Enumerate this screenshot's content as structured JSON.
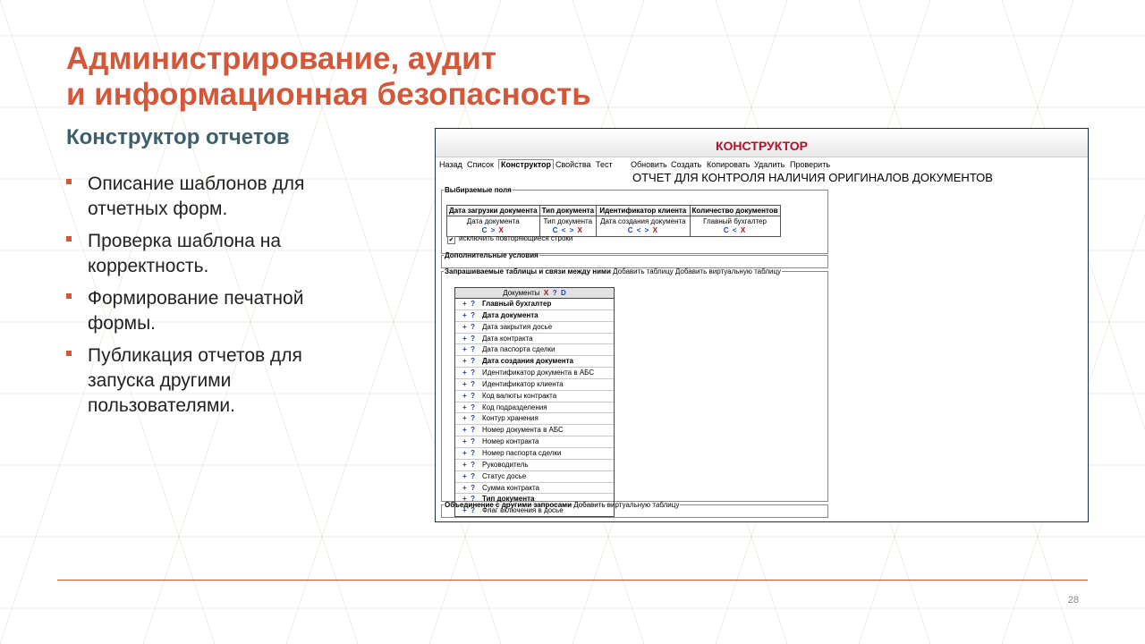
{
  "slide": {
    "title_line1": "Администрирование, аудит",
    "title_line2": "и информационная безопасность",
    "subtitle": "Конструктор отчетов",
    "bullets": [
      "Описание шаблонов для отчетных форм.",
      "Проверка шаблона на корректность.",
      "Формирование печатной формы.",
      "Публикация отчетов для запуска другими пользователями."
    ],
    "page_number": "28",
    "colors": {
      "accent": "#d4573a",
      "subtitle": "#3c5f6b",
      "header_red": "#b2102c",
      "control_blue": "#1a3cc8",
      "control_red": "#d20000"
    }
  },
  "screenshot": {
    "header": "КОНСТРУКТОР",
    "nav": [
      "Назад",
      "Список",
      "Конструктор",
      "Свойства",
      "Тест"
    ],
    "actions": [
      "Обновить",
      "Создать",
      "Копировать",
      "Удалить",
      "Проверить"
    ],
    "report_title": "ОТЧЕТ ДЛЯ КОНТРОЛЯ НАЛИЧИЯ ОРИГИНАЛОВ ДОКУМЕНТОВ",
    "selected_fields": {
      "legend": "Выбираемые поля",
      "columns": [
        {
          "header": "Дата загрузки документа",
          "value": "Дата документа",
          "controls": [
            "C",
            ">",
            "X"
          ]
        },
        {
          "header": "Тип документа",
          "value": "Тип документа",
          "controls": [
            "C",
            "<",
            ">",
            "X"
          ]
        },
        {
          "header": "Идентификатор клиента",
          "value": "Дата создания документа",
          "controls": [
            "C",
            "<",
            ">",
            "X"
          ]
        },
        {
          "header": "Количество документов",
          "value": "Главный бухгалтер",
          "controls": [
            "C",
            "<",
            "X"
          ]
        }
      ],
      "exclude_duplicates_label": "исключить повторяющиеся строки",
      "exclude_duplicates_checked": true
    },
    "additional_conditions": {
      "legend": "Дополнительные условия"
    },
    "tables_section": {
      "legend": "Запрашиваемые таблицы и связи между ними",
      "add_table": "Добавить таблицу",
      "add_virtual_table": "Добавить виртуальную таблицу",
      "documents_table": {
        "title": "Документы",
        "controls": [
          "X",
          "?",
          "D"
        ],
        "row_buttons": [
          "+",
          "?"
        ],
        "rows": [
          {
            "label": "Главный бухгалтер",
            "bold": true
          },
          {
            "label": "Дата документа",
            "bold": true
          },
          {
            "label": "Дата закрытия досье",
            "bold": false
          },
          {
            "label": "Дата контракта",
            "bold": false
          },
          {
            "label": "Дата паспорта сделки",
            "bold": false
          },
          {
            "label": "Дата создания документа",
            "bold": true
          },
          {
            "label": "Идентификатор документа в АБС",
            "bold": false
          },
          {
            "label": "Идентификатор клиента",
            "bold": false
          },
          {
            "label": "Код валюты контракта",
            "bold": false
          },
          {
            "label": "Код подразделения",
            "bold": false
          },
          {
            "label": "Контур хранения",
            "bold": false
          },
          {
            "label": "Номер документа в АБС",
            "bold": false
          },
          {
            "label": "Номер контракта",
            "bold": false
          },
          {
            "label": "Номер паспорта сделки",
            "bold": false
          },
          {
            "label": "Руководитель",
            "bold": false
          },
          {
            "label": "Статус досье",
            "bold": false
          },
          {
            "label": "Сумма контракта",
            "bold": false
          },
          {
            "label": "Тип документа",
            "bold": true
          },
          {
            "label": "Флаг включения в досье",
            "bold": false
          }
        ]
      }
    },
    "union_section": {
      "legend": "Объединение с другими запросами",
      "add_virtual_table": "Добавить виртуальную таблицу"
    }
  }
}
